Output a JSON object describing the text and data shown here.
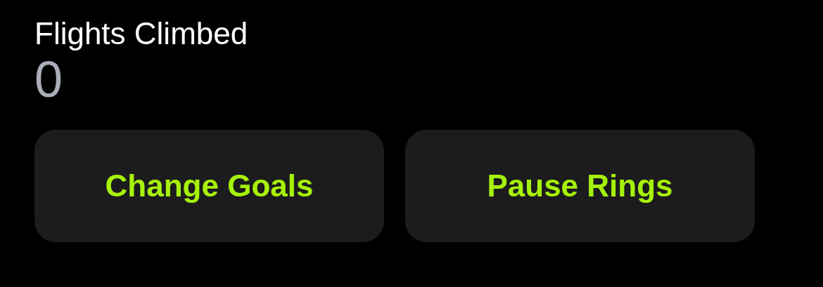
{
  "metric": {
    "label": "Flights Climbed",
    "value": "0"
  },
  "buttons": [
    {
      "label": "Change Goals"
    },
    {
      "label": "Pause Rings"
    }
  ]
}
